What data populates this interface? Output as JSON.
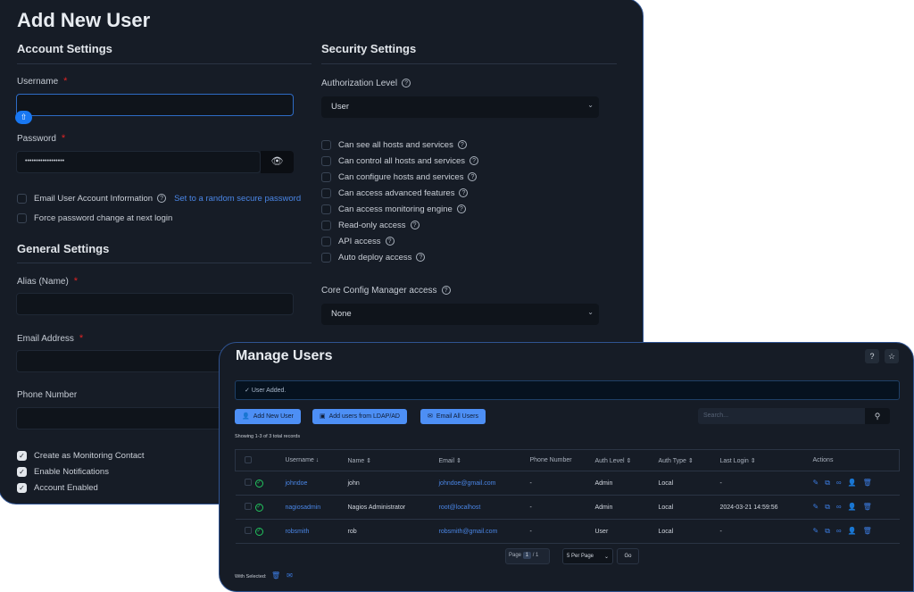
{
  "add_user": {
    "title": "Add New User",
    "account_settings": {
      "heading": "Account Settings",
      "username_label": "Username",
      "username_value": "",
      "password_label": "Password",
      "password_value": "••••••••••••••••••",
      "email_info_label": "Email User Account Information",
      "random_password_link": "Set to a random secure password",
      "force_change_label": "Force password change at next login",
      "required_mark": "*"
    },
    "general_settings": {
      "heading": "General Settings",
      "alias_label": "Alias (Name)",
      "email_label": "Email Address",
      "phone_label": "Phone Number",
      "checkboxes": [
        {
          "label": "Create as Monitoring Contact",
          "checked": true
        },
        {
          "label": "Enable Notifications",
          "checked": true
        },
        {
          "label": "Account Enabled",
          "checked": true
        }
      ]
    },
    "security_settings": {
      "heading": "Security Settings",
      "auth_level_label": "Authorization Level",
      "auth_level_value": "User",
      "permissions": [
        {
          "label": "Can see all hosts and services",
          "checked": false
        },
        {
          "label": "Can control all hosts and services",
          "checked": false
        },
        {
          "label": "Can configure hosts and services",
          "checked": false
        },
        {
          "label": "Can access advanced features",
          "checked": false
        },
        {
          "label": "Can access monitoring engine",
          "checked": false
        },
        {
          "label": "Read-only access",
          "checked": false
        },
        {
          "label": "API access",
          "checked": false
        },
        {
          "label": "Auto deploy access",
          "checked": false
        }
      ],
      "ccm_label": "Core Config Manager access",
      "ccm_value": "None"
    }
  },
  "manage_users": {
    "title": "Manage Users",
    "alert": "User Added.",
    "buttons": {
      "add": "Add New User",
      "ldap": "Add users from LDAP/AD",
      "email": "Email All Users"
    },
    "search_placeholder": "Search...",
    "records": "Showing 1-3 of 3 total records",
    "columns": [
      "Username ↓",
      "Name ⇕",
      "Email ⇕",
      "Phone Number",
      "Auth Level ⇕",
      "Auth Type ⇕",
      "Last Login ⇕",
      "Actions"
    ],
    "rows": [
      {
        "username": "johndoe",
        "name": "john",
        "email": "johndoe@gmail.com",
        "phone": "-",
        "auth_level": "Admin",
        "auth_type": "Local",
        "last_login": "-"
      },
      {
        "username": "nagiosadmin",
        "name": "Nagios Administrator",
        "email": "root@localhost",
        "phone": "-",
        "auth_level": "Admin",
        "auth_type": "Local",
        "last_login": "2024-03-21 14:59:56"
      },
      {
        "username": "robsmith",
        "name": "rob",
        "email": "robsmith@gmail.com",
        "phone": "-",
        "auth_level": "User",
        "auth_type": "Local",
        "last_login": "-"
      }
    ],
    "pagination": {
      "page_label": "Page",
      "current": "1",
      "total": "/ 1",
      "per_page": "5 Per Page",
      "go": "Go"
    },
    "with_selected": "With Selected:",
    "colors": {
      "accent": "#4d8ff5",
      "link": "#4a86e6",
      "success": "#22c55e",
      "required": "#e02424"
    }
  }
}
